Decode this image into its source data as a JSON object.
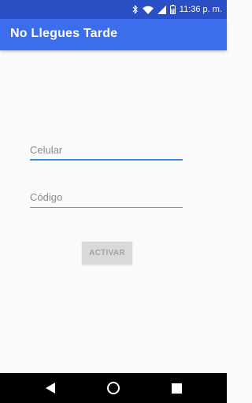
{
  "status_bar": {
    "time": "11:36 p. m."
  },
  "app_bar": {
    "title": "No Llegues Tarde"
  },
  "form": {
    "celular_placeholder": "Celular",
    "celular_value": "",
    "codigo_placeholder": "Código",
    "codigo_value": "",
    "activate_label": "ACTIVAR"
  },
  "icons": {
    "status": [
      "bluetooth-icon",
      "wifi-icon",
      "signal-icon",
      "battery-icon"
    ],
    "nav": [
      "back-icon",
      "home-icon",
      "recents-icon"
    ]
  },
  "colors": {
    "status_bar": "#2a4fc4",
    "app_bar": "#3b6ded",
    "focus_underline": "#3b8ded",
    "button_disabled": "#d9d9d9"
  }
}
